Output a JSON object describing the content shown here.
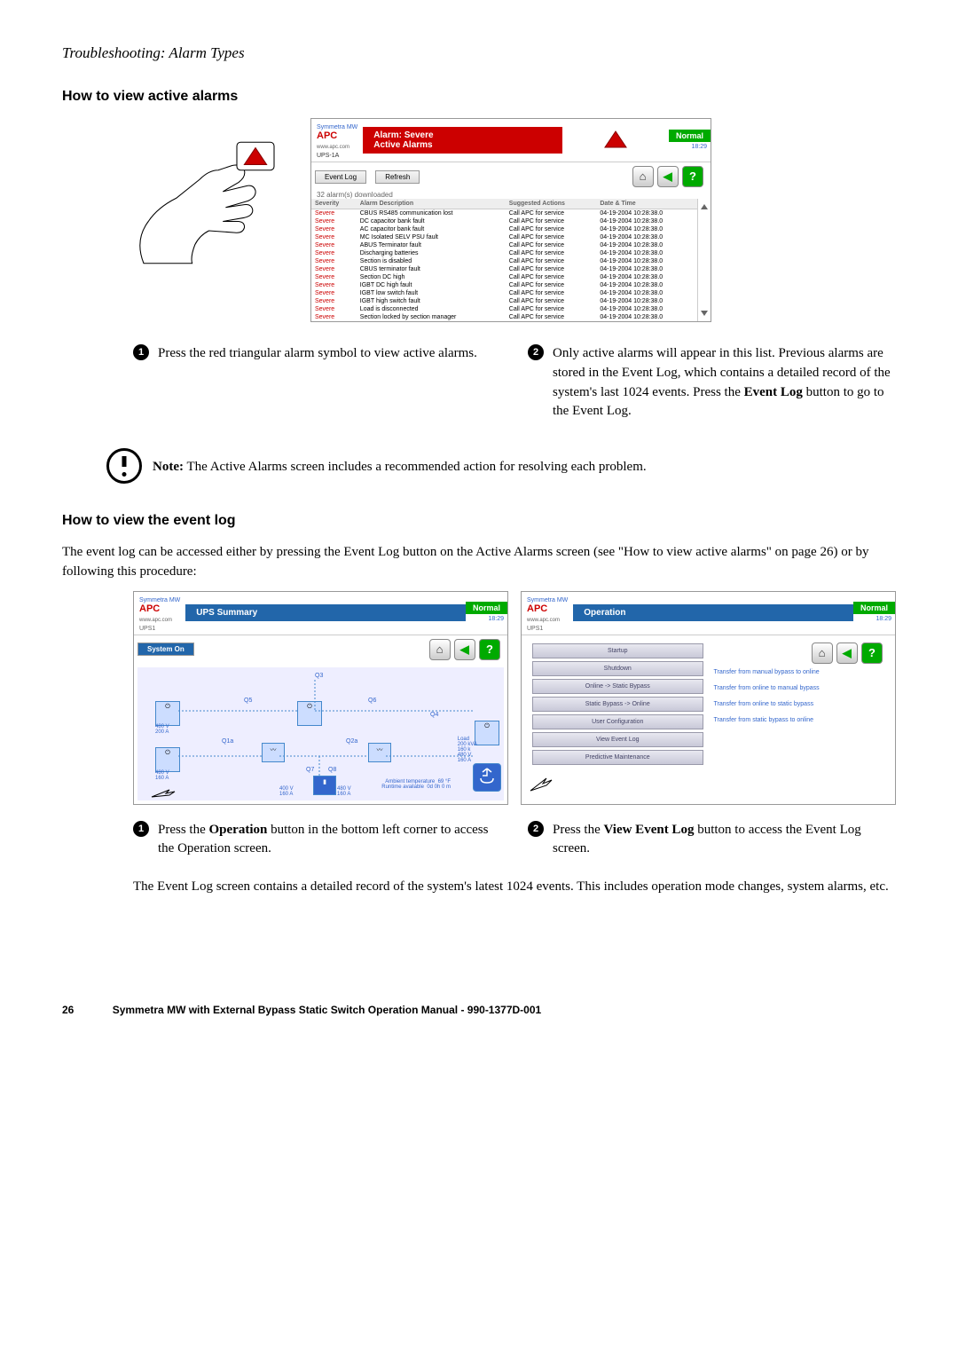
{
  "header": "Troubleshooting: Alarm Types",
  "section1_title": "How to view active alarms",
  "alarm_screen": {
    "brand_line1": "Symmetra MW",
    "brand_logo": "APC",
    "brand_url": "www.apc.com",
    "ups_label": "UPS-1A",
    "title_line1": "Alarm: Severe",
    "title_line2": "Active Alarms",
    "status": "Normal",
    "time": "18:29",
    "btn_event_log": "Event Log",
    "btn_refresh": "Refresh",
    "downloaded_text": "32 alarm(s) downloaded",
    "col1": "Severity",
    "col2": "Alarm Description",
    "col3": "Suggested Actions",
    "col4": "Date & Time",
    "rows": [
      {
        "sev": "Severe",
        "desc": "CBUS RS485 communication lost",
        "act": "Call APC for service",
        "dt": "04-19-2004 10:28:38.0"
      },
      {
        "sev": "Severe",
        "desc": "DC capacitor bank fault",
        "act": "Call APC for service",
        "dt": "04-19-2004 10:28:38.0"
      },
      {
        "sev": "Severe",
        "desc": "AC capacitor bank fault",
        "act": "Call APC for service",
        "dt": "04-19-2004 10:28:38.0"
      },
      {
        "sev": "Severe",
        "desc": "MC Isolated SELV PSU fault",
        "act": "Call APC for service",
        "dt": "04-19-2004 10:28:38.0"
      },
      {
        "sev": "Severe",
        "desc": "ABUS Terminator fault",
        "act": "Call APC for service",
        "dt": "04-19-2004 10:28:38.0"
      },
      {
        "sev": "Severe",
        "desc": "Discharging batteries",
        "act": "Call APC for service",
        "dt": "04-19-2004 10:28:38.0"
      },
      {
        "sev": "Severe",
        "desc": "Section is disabled",
        "act": "Call APC for service",
        "dt": "04-19-2004 10:28:38.0"
      },
      {
        "sev": "Severe",
        "desc": "CBUS terminator fault",
        "act": "Call APC for service",
        "dt": "04-19-2004 10:28:38.0"
      },
      {
        "sev": "Severe",
        "desc": "Section DC high",
        "act": "Call APC for service",
        "dt": "04-19-2004 10:28:38.0"
      },
      {
        "sev": "Severe",
        "desc": "IGBT DC high fault",
        "act": "Call APC for service",
        "dt": "04-19-2004 10:28:38.0"
      },
      {
        "sev": "Severe",
        "desc": "IGBT low switch fault",
        "act": "Call APC for service",
        "dt": "04-19-2004 10:28:38.0"
      },
      {
        "sev": "Severe",
        "desc": "IGBT high switch fault",
        "act": "Call APC for service",
        "dt": "04-19-2004 10:28:38.0"
      },
      {
        "sev": "Severe",
        "desc": "Load is disconnected",
        "act": "Call APC for service",
        "dt": "04-19-2004 10:28:38.0"
      },
      {
        "sev": "Severe",
        "desc": "Section locked by section manager",
        "act": "Call APC for service",
        "dt": "04-19-2004 10:28:38.0"
      }
    ]
  },
  "step1_text": "Press the red triangular alarm symbol to view active alarms.",
  "step2_pre": "Only active alarms will appear in this list. Previous alarms are stored in the Event Log, which contains a detailed record of the system's last 1024 events. Press the ",
  "step2_bold": "Event Log",
  "step2_post": " button to go to the Event Log.",
  "note_label": "Note:",
  "note_text": " The Active Alarms screen includes a recommended action for resolving each problem.",
  "section2_title": "How to view the event log",
  "eventlog_intro": "The event log can be accessed either by pressing the Event Log button on the Active Alarms screen (see \"How to view active alarms\" on page 26) or by following this procedure:",
  "ups_screen": {
    "title": "UPS Summary",
    "ups_label": "UPS1",
    "status": "Normal",
    "time": "18:29",
    "system_status": "System On",
    "labels": {
      "q3": "Q3",
      "q5": "Q5",
      "q6": "Q6",
      "q4": "Q4",
      "q1a": "Q1a",
      "q2a": "Q2a",
      "q7": "Q7",
      "q8": "Q8"
    },
    "readings": {
      "r1": "480 V",
      "r1b": "200 A",
      "r2": "480 V",
      "r2b": "160 A",
      "load": "Load",
      "loadv": "200 kVA",
      "loadp": "160 k",
      "loadvv": "480 V",
      "loada": "160 A",
      "bat1": "400 V",
      "bat1a": "160 A",
      "bat2": "480 V",
      "bat2a": "160 A",
      "amb": "Ambient temperature",
      "ambv": "69 °F",
      "run": "Runtime available",
      "runv": "0d 0h 0 m"
    }
  },
  "op_screen": {
    "title": "Operation",
    "ups_label": "UPS1",
    "status": "Normal",
    "time": "18:29",
    "items": [
      {
        "btn": "Startup",
        "lbl": "Transfer from manual bypass to online"
      },
      {
        "btn": "Shutdown",
        "lbl": "Transfer from online to manual bypass"
      },
      {
        "btn": "Online -> Static Bypass",
        "lbl": "Transfer from online to static bypass"
      },
      {
        "btn": "Static Bypass -> Online",
        "lbl": "Transfer from static bypass to online"
      },
      {
        "btn": "User Configuration",
        "lbl": ""
      },
      {
        "btn": "View Event Log",
        "lbl": ""
      },
      {
        "btn": "Predictive Maintenance",
        "lbl": ""
      }
    ]
  },
  "step3_pre": "Press the ",
  "step3_bold": "Operation",
  "step3_post": " button in the bottom left corner to access the Operation screen.",
  "step4_pre": "Press the ",
  "step4_bold": "View Event Log",
  "step4_post": " button to access the Event Log screen.",
  "closing": "The Event Log screen contains a detailed record of the system's latest 1024 events. This includes operation mode changes, system alarms, etc.",
  "page_num": "26",
  "footer_text": "Symmetra MW with External Bypass Static Switch Operation Manual - 990-1377D-001"
}
